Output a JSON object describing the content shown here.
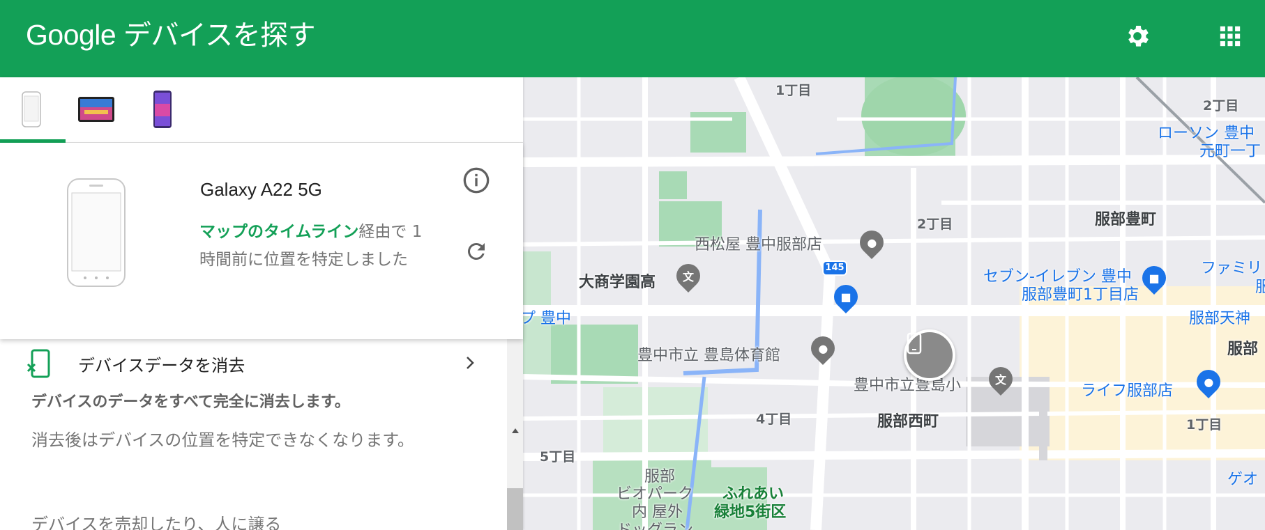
{
  "header": {
    "brand_google": "Google",
    "brand_title": "デバイスを探す",
    "settings_icon": "gear-icon",
    "apps_icon": "apps-grid-icon",
    "background_color": "#13a057"
  },
  "device_tabs": [
    {
      "icon": "phone-white-icon",
      "selected": true
    },
    {
      "icon": "tablet-icon",
      "selected": false
    },
    {
      "icon": "phone-purple-icon",
      "selected": false
    }
  ],
  "device_card": {
    "name": "Galaxy A22 5G",
    "status_link": "マップのタイムライン",
    "status_text": "経由で 1 時間前に位置を特定しました",
    "info_icon": "info-icon",
    "refresh_icon": "refresh-icon"
  },
  "erase": {
    "title": "デバイスデータを消去",
    "icon": "erase-phone-icon",
    "chevron_icon": "chevron-right-icon",
    "description_bold": "デバイスのデータをすべて完全に消去します。",
    "description": "消去後はデバイスの位置を特定できなくなります。",
    "more_text": "デバイスを売却したり、人に譲る"
  },
  "map": {
    "labels": {
      "chome1_top": "1丁目",
      "chome2_top_right": "2丁目",
      "lawson": "ローソン 豊中",
      "motomachi": "元町一丁",
      "chome2_mid": "2丁目",
      "hattori_yutaka": "服部豊町",
      "nishimatsuya": "西松屋 豊中服部店",
      "daisho": "大商学園高",
      "seven_line1": "セブン-イレブン 豊中",
      "seven_line2": "服部豊町1丁目店",
      "family": "ファミリ",
      "family2": "服",
      "toyonaka_left": "プ 豊中",
      "toyoshima_gym": "豊中市立 豊島体育館",
      "hattori_tenjin": "服部天神",
      "hattori_right": "服部",
      "toyoshima_school": "豊中市立豊島小",
      "life": "ライフ服部店",
      "chome4": "4丁目",
      "hattori_nishimachi": "服部西町",
      "chome1_bottom": "1丁目",
      "chome5": "5丁目",
      "geo": "ゲオ",
      "park1": "服部",
      "park2": "ビオパーク",
      "park3": "内 屋外",
      "park4": "ドッグラン",
      "fureai1": "ふれあい",
      "fureai2": "緑地5街区",
      "route_number": "145"
    }
  }
}
